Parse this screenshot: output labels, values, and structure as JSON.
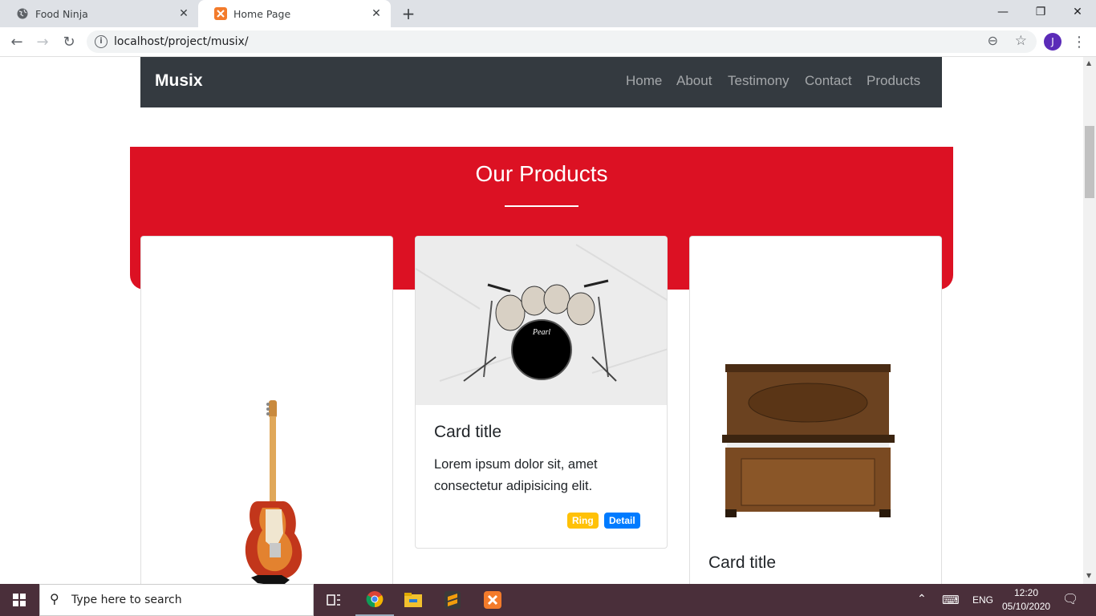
{
  "browser": {
    "tabs": [
      {
        "title": "Food Ninja",
        "icon": "globe-icon"
      },
      {
        "title": "Home Page",
        "icon": "xampp-icon"
      }
    ],
    "url": "localhost/project/musix/",
    "profile_initial": "J"
  },
  "site": {
    "brand": "Musix",
    "nav": [
      "Home",
      "About",
      "Testimony",
      "Contact",
      "Products"
    ],
    "section_title": "Our Products",
    "colors": {
      "navbar": "#343a40",
      "banner": "#dc1123",
      "badge_ring": "#ffc107",
      "badge_detail": "#007bff"
    },
    "cards": [
      {
        "image": "guitar",
        "title": "",
        "text": "",
        "badges": []
      },
      {
        "image": "drum-kit",
        "title": "Card title",
        "text": "Lorem ipsum dolor sit, amet consectetur adipisicing elit.",
        "badges": [
          "Ring",
          "Detail"
        ]
      },
      {
        "image": "piano",
        "title": "Card title",
        "text": "",
        "badges": []
      }
    ]
  },
  "taskbar": {
    "search_placeholder": "Type here to search",
    "language": "ENG",
    "time": "12:20",
    "date": "05/10/2020"
  }
}
